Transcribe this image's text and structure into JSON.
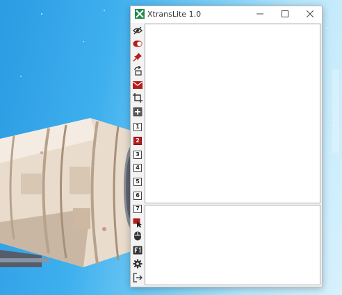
{
  "window": {
    "title": "XtransLite 1.0"
  },
  "toolbar": {
    "number_buttons": [
      "1",
      "2",
      "3",
      "4",
      "5",
      "6",
      "7"
    ],
    "active_number": "2"
  },
  "colors": {
    "accent_red": "#b51c1c",
    "icon_dark": "#333333",
    "app_icon_green": "#1f8a4c"
  },
  "icons": [
    "eye-slash-icon",
    "toggle-icon",
    "pin-icon",
    "share-icon",
    "mail-icon",
    "crop-icon",
    "plus-box-icon",
    "select-region-icon",
    "mouse-icon",
    "f1-key-icon",
    "gear-icon",
    "exit-icon"
  ]
}
